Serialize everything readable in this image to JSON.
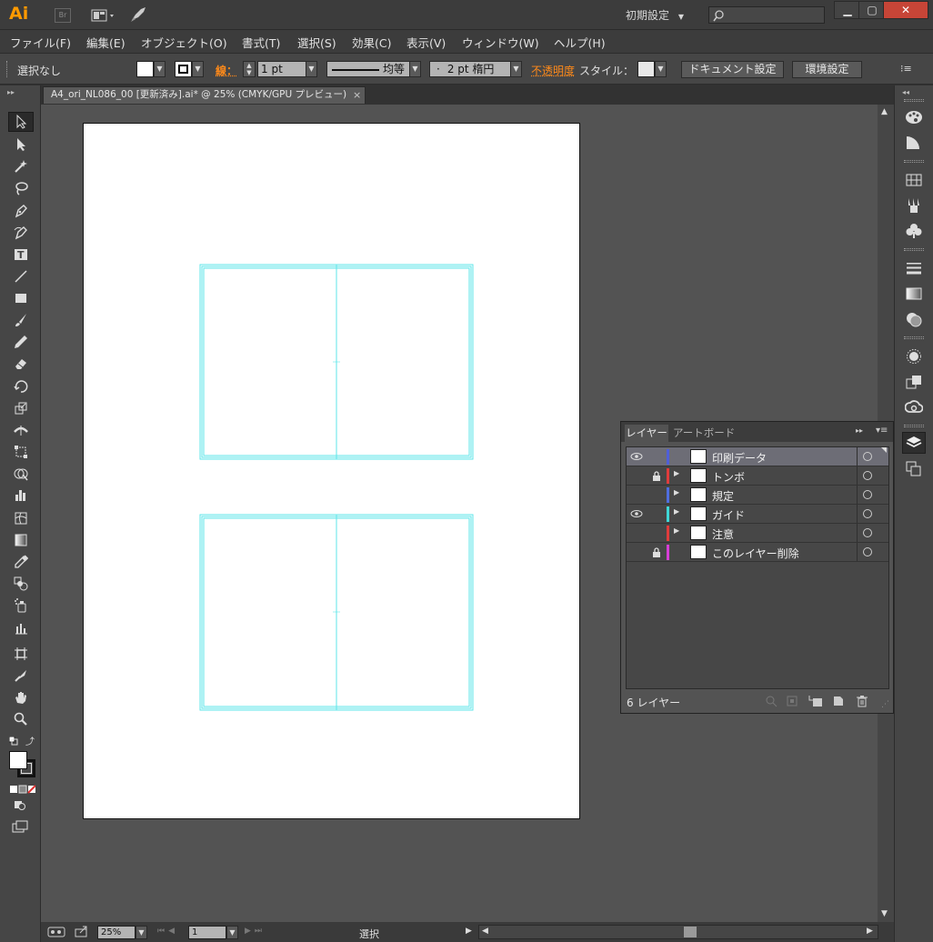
{
  "app": {
    "logo": "Ai",
    "bridge": "Br",
    "preset": "初期設定",
    "window_controls": {
      "minimize": "▁",
      "maximize": "▢",
      "close": "✕"
    }
  },
  "menu": [
    "ファイル(F)",
    "編集(E)",
    "オブジェクト(O)",
    "書式(T)",
    "選択(S)",
    "効果(C)",
    "表示(V)",
    "ウィンドウ(W)",
    "ヘルプ(H)"
  ],
  "control": {
    "selection": "選択なし",
    "stroke_label": "線：",
    "stroke_weight": "1 pt",
    "stroke_profile": "均等",
    "brush": "2 pt 楕円",
    "brush_dot": "·",
    "opacity": "不透明度",
    "style_label": "スタイル：",
    "doc_setup": "ドキュメント設定",
    "prefs": "環境設定"
  },
  "document": {
    "tab_title": "A4_ori_NL086_00 [更新済み].ai* @ 25% (CMYK/GPU プレビュー)",
    "tab_close": "×"
  },
  "layers_panel": {
    "tab_layers": "レイヤー",
    "tab_artboards": "アートボード",
    "layers": [
      {
        "name": "印刷データ",
        "visible": true,
        "locked": false,
        "color": "#4f5fd8",
        "expandable": false,
        "active": true
      },
      {
        "name": "トンボ",
        "visible": false,
        "locked": true,
        "color": "#e03c3c",
        "expandable": true,
        "active": false
      },
      {
        "name": "規定",
        "visible": false,
        "locked": false,
        "color": "#4f6ee0",
        "expandable": true,
        "active": false
      },
      {
        "name": "ガイド",
        "visible": true,
        "locked": false,
        "color": "#3fd8d8",
        "expandable": true,
        "active": false
      },
      {
        "name": "注意",
        "visible": false,
        "locked": false,
        "color": "#e03c3c",
        "expandable": true,
        "active": false
      },
      {
        "name": "このレイヤー削除",
        "visible": false,
        "locked": true,
        "color": "#d83fd8",
        "expandable": false,
        "active": false
      }
    ],
    "count": "6 レイヤー"
  },
  "status": {
    "zoom": "25%",
    "artboard": "1",
    "tool": "選択"
  },
  "colors": {
    "guide": "#5ee6ea",
    "accent": "#ff8a1a"
  }
}
